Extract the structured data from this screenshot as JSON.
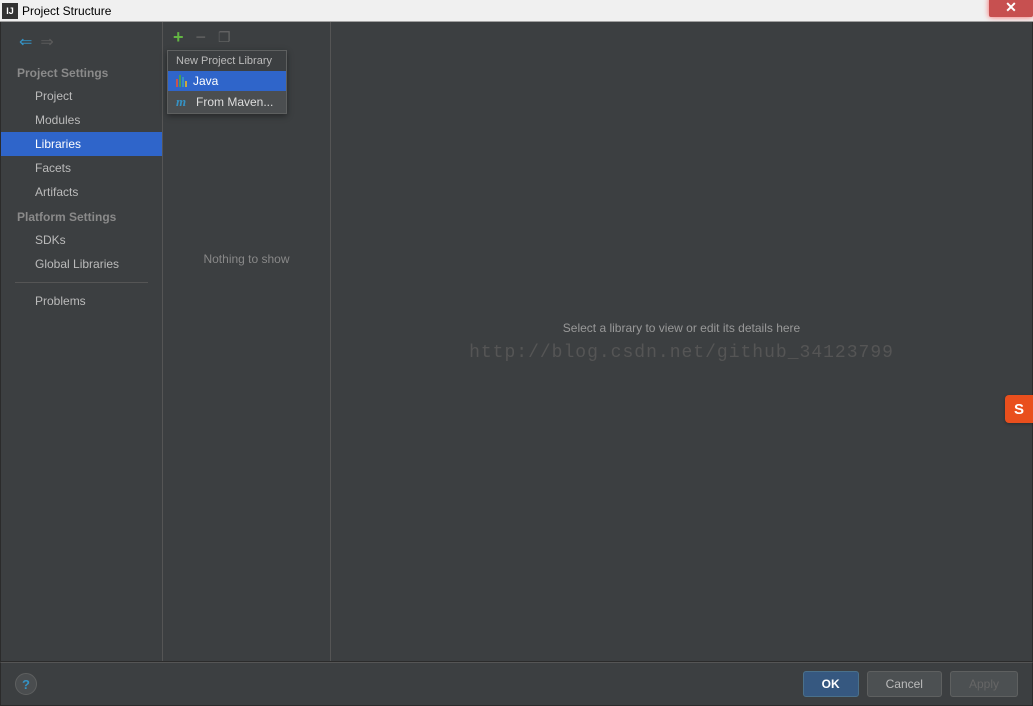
{
  "titlebar": {
    "icon_text": "IJ",
    "title": "Project Structure"
  },
  "sidebar": {
    "section1": "Project Settings",
    "items1": [
      "Project",
      "Modules",
      "Libraries",
      "Facets",
      "Artifacts"
    ],
    "selected1": 2,
    "section2": "Platform Settings",
    "items2": [
      "SDKs",
      "Global Libraries"
    ],
    "section3_item": "Problems"
  },
  "popup": {
    "header": "New Project Library",
    "items": [
      {
        "label": "Java"
      },
      {
        "label": "From Maven..."
      }
    ],
    "selected": 0
  },
  "middle": {
    "nothing": "Nothing to show"
  },
  "main": {
    "message": "Select a library to view or edit its details here",
    "watermark": "http://blog.csdn.net/github_34123799"
  },
  "footer": {
    "ok": "OK",
    "cancel": "Cancel",
    "apply": "Apply"
  },
  "ime": "S"
}
